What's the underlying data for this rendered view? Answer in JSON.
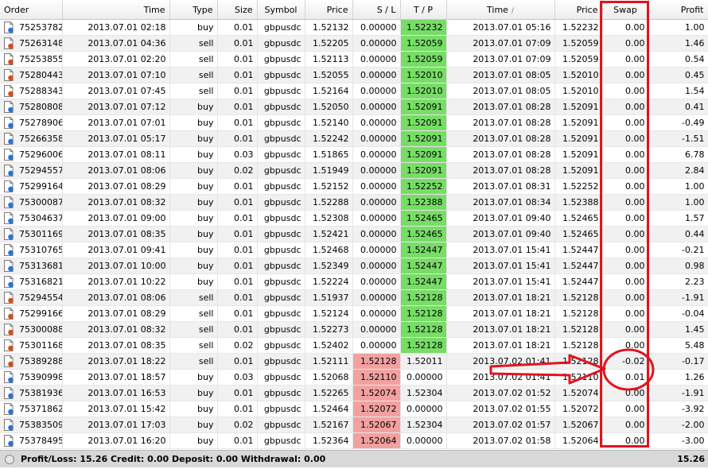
{
  "columns": {
    "order": "Order",
    "open_time": "Time",
    "type": "Type",
    "size": "Size",
    "symbol": "Symbol",
    "open_price": "Price",
    "sl": "S / L",
    "tp": "T / P",
    "close_time": "Time",
    "close_time_sort": "/",
    "close_price": "Price",
    "swap": "Swap",
    "profit": "Profit"
  },
  "rows": [
    {
      "order": "75253782",
      "open_time": "2013.07.01 02:18",
      "type": "buy",
      "size": "0.01",
      "symbol": "gbpusdc",
      "open_price": "1.52132",
      "sl": "0.00000",
      "tp": "1.52232",
      "close_time": "2013.07.01 05:16",
      "close_price": "1.52232",
      "swap": "0.00",
      "profit": "1.00",
      "hit": "tp"
    },
    {
      "order": "75263148",
      "open_time": "2013.07.01 04:36",
      "type": "sell",
      "size": "0.01",
      "symbol": "gbpusdc",
      "open_price": "1.52205",
      "sl": "0.00000",
      "tp": "1.52059",
      "close_time": "2013.07.01 07:09",
      "close_price": "1.52059",
      "swap": "0.00",
      "profit": "1.46",
      "hit": "tp"
    },
    {
      "order": "75253855",
      "open_time": "2013.07.01 02:20",
      "type": "sell",
      "size": "0.01",
      "symbol": "gbpusdc",
      "open_price": "1.52113",
      "sl": "0.00000",
      "tp": "1.52059",
      "close_time": "2013.07.01 07:09",
      "close_price": "1.52059",
      "swap": "0.00",
      "profit": "0.54",
      "hit": "tp"
    },
    {
      "order": "75280443",
      "open_time": "2013.07.01 07:10",
      "type": "sell",
      "size": "0.01",
      "symbol": "gbpusdc",
      "open_price": "1.52055",
      "sl": "0.00000",
      "tp": "1.52010",
      "close_time": "2013.07.01 08:05",
      "close_price": "1.52010",
      "swap": "0.00",
      "profit": "0.45",
      "hit": "tp"
    },
    {
      "order": "75288343",
      "open_time": "2013.07.01 07:45",
      "type": "sell",
      "size": "0.01",
      "symbol": "gbpusdc",
      "open_price": "1.52164",
      "sl": "0.00000",
      "tp": "1.52010",
      "close_time": "2013.07.01 08:05",
      "close_price": "1.52010",
      "swap": "0.00",
      "profit": "1.54",
      "hit": "tp"
    },
    {
      "order": "75280808",
      "open_time": "2013.07.01 07:12",
      "type": "buy",
      "size": "0.01",
      "symbol": "gbpusdc",
      "open_price": "1.52050",
      "sl": "0.00000",
      "tp": "1.52091",
      "close_time": "2013.07.01 08:28",
      "close_price": "1.52091",
      "swap": "0.00",
      "profit": "0.41",
      "hit": "tp"
    },
    {
      "order": "75278906",
      "open_time": "2013.07.01 07:01",
      "type": "buy",
      "size": "0.01",
      "symbol": "gbpusdc",
      "open_price": "1.52140",
      "sl": "0.00000",
      "tp": "1.52091",
      "close_time": "2013.07.01 08:28",
      "close_price": "1.52091",
      "swap": "0.00",
      "profit": "-0.49",
      "hit": "tp"
    },
    {
      "order": "75266358",
      "open_time": "2013.07.01 05:17",
      "type": "buy",
      "size": "0.01",
      "symbol": "gbpusdc",
      "open_price": "1.52242",
      "sl": "0.00000",
      "tp": "1.52091",
      "close_time": "2013.07.01 08:28",
      "close_price": "1.52091",
      "swap": "0.00",
      "profit": "-1.51",
      "hit": "tp"
    },
    {
      "order": "75296006",
      "open_time": "2013.07.01 08:11",
      "type": "buy",
      "size": "0.03",
      "symbol": "gbpusdc",
      "open_price": "1.51865",
      "sl": "0.00000",
      "tp": "1.52091",
      "close_time": "2013.07.01 08:28",
      "close_price": "1.52091",
      "swap": "0.00",
      "profit": "6.78",
      "hit": "tp"
    },
    {
      "order": "75294557",
      "open_time": "2013.07.01 08:06",
      "type": "buy",
      "size": "0.02",
      "symbol": "gbpusdc",
      "open_price": "1.51949",
      "sl": "0.00000",
      "tp": "1.52091",
      "close_time": "2013.07.01 08:28",
      "close_price": "1.52091",
      "swap": "0.00",
      "profit": "2.84",
      "hit": "tp"
    },
    {
      "order": "75299164",
      "open_time": "2013.07.01 08:29",
      "type": "buy",
      "size": "0.01",
      "symbol": "gbpusdc",
      "open_price": "1.52152",
      "sl": "0.00000",
      "tp": "1.52252",
      "close_time": "2013.07.01 08:31",
      "close_price": "1.52252",
      "swap": "0.00",
      "profit": "1.00",
      "hit": "tp"
    },
    {
      "order": "75300087",
      "open_time": "2013.07.01 08:32",
      "type": "buy",
      "size": "0.01",
      "symbol": "gbpusdc",
      "open_price": "1.52288",
      "sl": "0.00000",
      "tp": "1.52388",
      "close_time": "2013.07.01 08:34",
      "close_price": "1.52388",
      "swap": "0.00",
      "profit": "1.00",
      "hit": "tp"
    },
    {
      "order": "75304637",
      "open_time": "2013.07.01 09:00",
      "type": "buy",
      "size": "0.01",
      "symbol": "gbpusdc",
      "open_price": "1.52308",
      "sl": "0.00000",
      "tp": "1.52465",
      "close_time": "2013.07.01 09:40",
      "close_price": "1.52465",
      "swap": "0.00",
      "profit": "1.57",
      "hit": "tp"
    },
    {
      "order": "75301169",
      "open_time": "2013.07.01 08:35",
      "type": "buy",
      "size": "0.01",
      "symbol": "gbpusdc",
      "open_price": "1.52421",
      "sl": "0.00000",
      "tp": "1.52465",
      "close_time": "2013.07.01 09:40",
      "close_price": "1.52465",
      "swap": "0.00",
      "profit": "0.44",
      "hit": "tp"
    },
    {
      "order": "75310765",
      "open_time": "2013.07.01 09:41",
      "type": "buy",
      "size": "0.01",
      "symbol": "gbpusdc",
      "open_price": "1.52468",
      "sl": "0.00000",
      "tp": "1.52447",
      "close_time": "2013.07.01 15:41",
      "close_price": "1.52447",
      "swap": "0.00",
      "profit": "-0.21",
      "hit": "tp"
    },
    {
      "order": "75313681",
      "open_time": "2013.07.01 10:00",
      "type": "buy",
      "size": "0.01",
      "symbol": "gbpusdc",
      "open_price": "1.52349",
      "sl": "0.00000",
      "tp": "1.52447",
      "close_time": "2013.07.01 15:41",
      "close_price": "1.52447",
      "swap": "0.00",
      "profit": "0.98",
      "hit": "tp"
    },
    {
      "order": "75316821",
      "open_time": "2013.07.01 10:22",
      "type": "buy",
      "size": "0.01",
      "symbol": "gbpusdc",
      "open_price": "1.52224",
      "sl": "0.00000",
      "tp": "1.52447",
      "close_time": "2013.07.01 15:41",
      "close_price": "1.52447",
      "swap": "0.00",
      "profit": "2.23",
      "hit": "tp"
    },
    {
      "order": "75294554",
      "open_time": "2013.07.01 08:06",
      "type": "sell",
      "size": "0.01",
      "symbol": "gbpusdc",
      "open_price": "1.51937",
      "sl": "0.00000",
      "tp": "1.52128",
      "close_time": "2013.07.01 18:21",
      "close_price": "1.52128",
      "swap": "0.00",
      "profit": "-1.91",
      "hit": "tp"
    },
    {
      "order": "75299166",
      "open_time": "2013.07.01 08:29",
      "type": "sell",
      "size": "0.01",
      "symbol": "gbpusdc",
      "open_price": "1.52124",
      "sl": "0.00000",
      "tp": "1.52128",
      "close_time": "2013.07.01 18:21",
      "close_price": "1.52128",
      "swap": "0.00",
      "profit": "-0.04",
      "hit": "tp"
    },
    {
      "order": "75300088",
      "open_time": "2013.07.01 08:32",
      "type": "sell",
      "size": "0.01",
      "symbol": "gbpusdc",
      "open_price": "1.52273",
      "sl": "0.00000",
      "tp": "1.52128",
      "close_time": "2013.07.01 18:21",
      "close_price": "1.52128",
      "swap": "0.00",
      "profit": "1.45",
      "hit": "tp"
    },
    {
      "order": "75301168",
      "open_time": "2013.07.01 08:35",
      "type": "sell",
      "size": "0.02",
      "symbol": "gbpusdc",
      "open_price": "1.52402",
      "sl": "0.00000",
      "tp": "1.52128",
      "close_time": "2013.07.01 18:21",
      "close_price": "1.52128",
      "swap": "0.00",
      "profit": "5.48",
      "hit": "tp"
    },
    {
      "order": "75389288",
      "open_time": "2013.07.01 18:22",
      "type": "sell",
      "size": "0.01",
      "symbol": "gbpusdc",
      "open_price": "1.52111",
      "sl": "1.52128",
      "tp": "1.52011",
      "close_time": "2013.07.02 01:41",
      "close_price": "1.52128",
      "swap": "-0.02",
      "profit": "-0.17",
      "hit": "sl"
    },
    {
      "order": "75390998",
      "open_time": "2013.07.01 18:57",
      "type": "buy",
      "size": "0.03",
      "symbol": "gbpusdc",
      "open_price": "1.52068",
      "sl": "1.52110",
      "tp": "0.00000",
      "close_time": "2013.07.02 01:41",
      "close_price": "1.52110",
      "swap": "0.01",
      "profit": "1.26",
      "hit": "sl"
    },
    {
      "order": "75381936",
      "open_time": "2013.07.01 16:53",
      "type": "buy",
      "size": "0.01",
      "symbol": "gbpusdc",
      "open_price": "1.52265",
      "sl": "1.52074",
      "tp": "1.52304",
      "close_time": "2013.07.02 01:52",
      "close_price": "1.52074",
      "swap": "0.00",
      "profit": "-1.91",
      "hit": "sl"
    },
    {
      "order": "75371862",
      "open_time": "2013.07.01 15:42",
      "type": "buy",
      "size": "0.01",
      "symbol": "gbpusdc",
      "open_price": "1.52464",
      "sl": "1.52072",
      "tp": "0.00000",
      "close_time": "2013.07.02 01:55",
      "close_price": "1.52072",
      "swap": "0.00",
      "profit": "-3.92",
      "hit": "sl"
    },
    {
      "order": "75383509",
      "open_time": "2013.07.01 17:03",
      "type": "buy",
      "size": "0.02",
      "symbol": "gbpusdc",
      "open_price": "1.52167",
      "sl": "1.52067",
      "tp": "1.52304",
      "close_time": "2013.07.02 01:57",
      "close_price": "1.52067",
      "swap": "0.00",
      "profit": "-2.00",
      "hit": "sl"
    },
    {
      "order": "75378495",
      "open_time": "2013.07.01 16:20",
      "type": "buy",
      "size": "0.01",
      "symbol": "gbpusdc",
      "open_price": "1.52364",
      "sl": "1.52064",
      "tp": "0.00000",
      "close_time": "2013.07.02 01:58",
      "close_price": "1.52064",
      "swap": "0.00",
      "profit": "-3.00",
      "hit": "sl"
    }
  ],
  "footer": {
    "summary": "Profit/Loss: 15.26  Credit: 0.00  Deposit: 0.00  Withdrawal: 0.00",
    "total": "15.26"
  },
  "colors": {
    "tp_highlight": "#77dd66",
    "sl_highlight": "#f2a1a1",
    "annotation": "#e0141e"
  },
  "icons": {
    "buy": "blue-order-icon",
    "sell": "red-order-icon",
    "footer": "circle-icon",
    "annotation": "red-arrow-and-circle"
  }
}
